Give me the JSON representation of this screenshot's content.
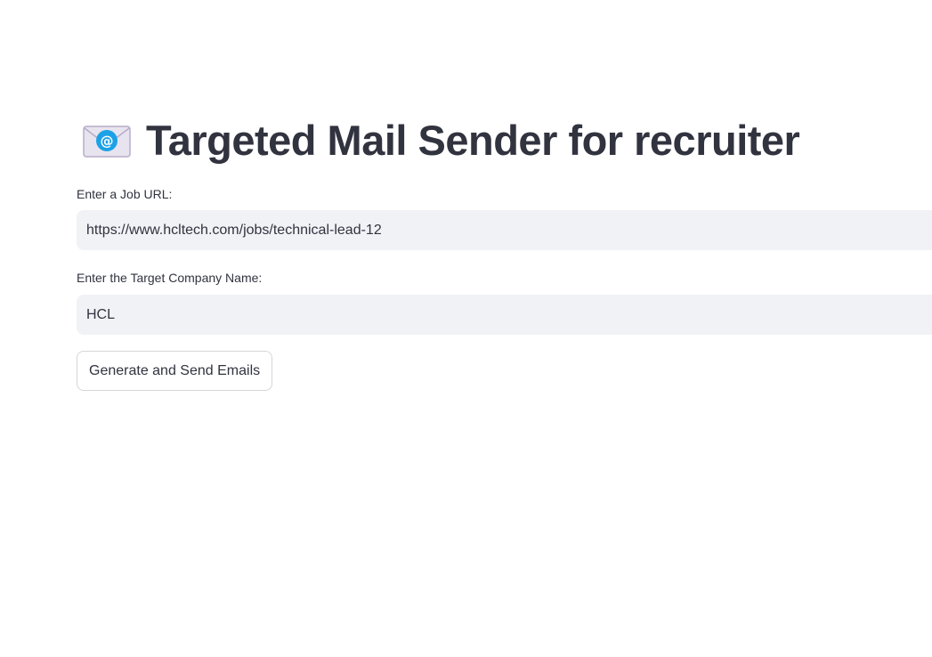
{
  "header": {
    "icon": "envelope-with-at-icon",
    "title": "Targeted Mail Sender for recruiter"
  },
  "form": {
    "job_url": {
      "label": "Enter a Job URL:",
      "value": "https://www.hcltech.com/jobs/technical-lead-12"
    },
    "company_name": {
      "label": "Enter the Target Company Name:",
      "value": "HCL"
    },
    "submit_label": "Generate and Send Emails"
  },
  "colors": {
    "text": "#31333f",
    "input_background": "#f0f2f6",
    "icon_accent": "#1da1e6"
  }
}
